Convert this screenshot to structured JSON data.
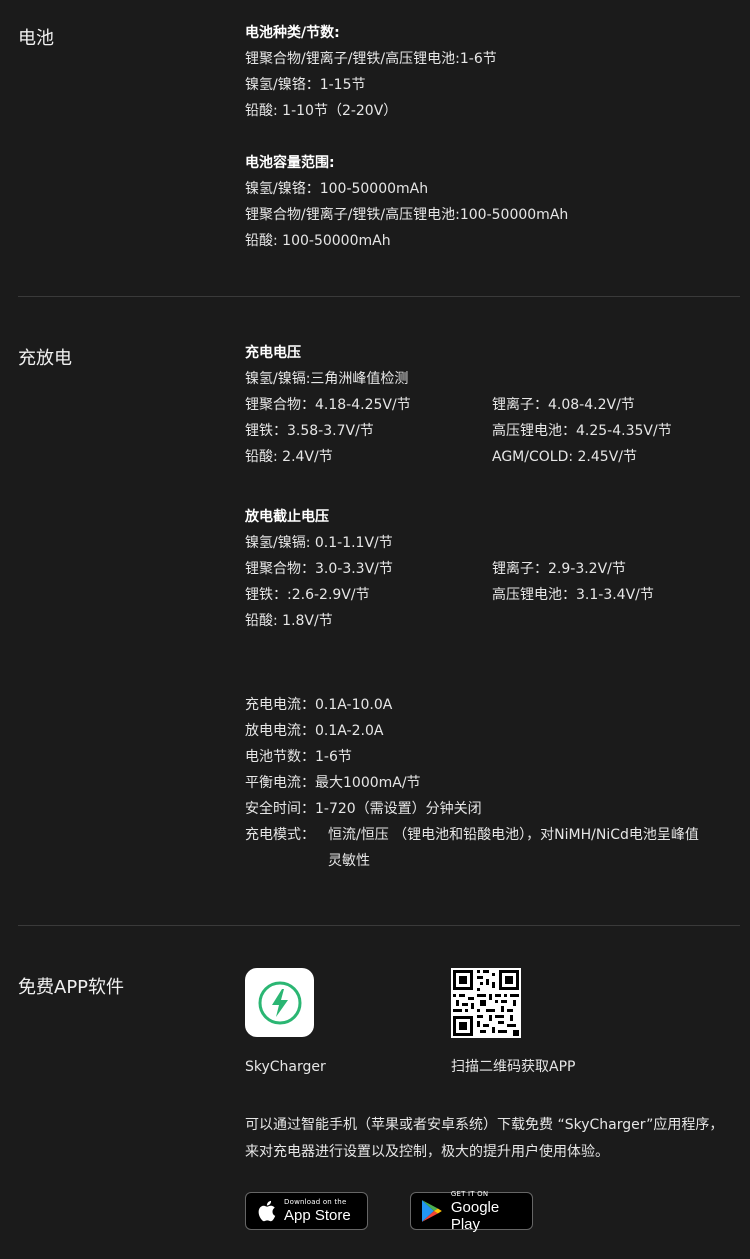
{
  "battery": {
    "title": "电池",
    "types_heading": "电池种类/节数:",
    "types": [
      "锂聚合物/锂离子/锂铁/高压锂电池:1-6节",
      "镍氢/镍铬：1-15节",
      "铅酸: 1-10节（2-20V）"
    ],
    "capacity_heading": "电池容量范围:",
    "capacity": [
      "镍氢/镍铬：100-50000mAh",
      "锂聚合物/锂离子/锂铁/高压锂电池:100-50000mAh",
      "铅酸: 100-50000mAh"
    ]
  },
  "charge": {
    "title": "充放电",
    "voltage_heading": "充电电压",
    "voltage_full": "镍氢/镍镉:三角洲峰值检测",
    "voltage_left": [
      "锂聚合物：4.18-4.25V/节",
      "锂铁：3.58-3.7V/节",
      "铅酸: 2.4V/节"
    ],
    "voltage_right": [
      "锂离子：4.08-4.2V/节",
      "高压锂电池：4.25-4.35V/节",
      "AGM/COLD: 2.45V/节"
    ],
    "cutoff_heading": "放电截止电压",
    "cutoff_full": "镍氢/镍镉: 0.1-1.1V/节",
    "cutoff_left": [
      "锂聚合物：3.0-3.3V/节",
      "锂铁：:2.6-2.9V/节",
      "铅酸: 1.8V/节"
    ],
    "cutoff_right": [
      "锂离子：2.9-3.2V/节",
      "高压锂电池：3.1-3.4V/节"
    ],
    "specs": [
      "充电电流：0.1A-10.0A",
      "放电电流：0.1A-2.0A",
      "电池节数：1-6节",
      "平衡电流：最大1000mA/节",
      "安全时间：1-720（需设置）分钟关闭"
    ],
    "mode_label": "充电模式：",
    "mode_line1": "恒流/恒压 （锂电池和铅酸电池），对NiMH/NiCd电池呈峰值",
    "mode_line2": "灵敏性"
  },
  "app": {
    "title": "免费APP软件",
    "app_name": "SkyCharger",
    "app_icon": "lightning-bolt-icon",
    "qr_caption": "扫描二维码获取APP",
    "description": "可以通过智能手机（苹果或者安卓系统）下载免费 “SkyCharger”应用程序，来对充电器进行设置以及控制，极大的提升用户使用体验。",
    "appstore_small": "Download on the",
    "appstore_big": "App Store",
    "googleplay_small": "GET IT ON",
    "googleplay_big": "Google Play",
    "accent": "#2bb673"
  }
}
